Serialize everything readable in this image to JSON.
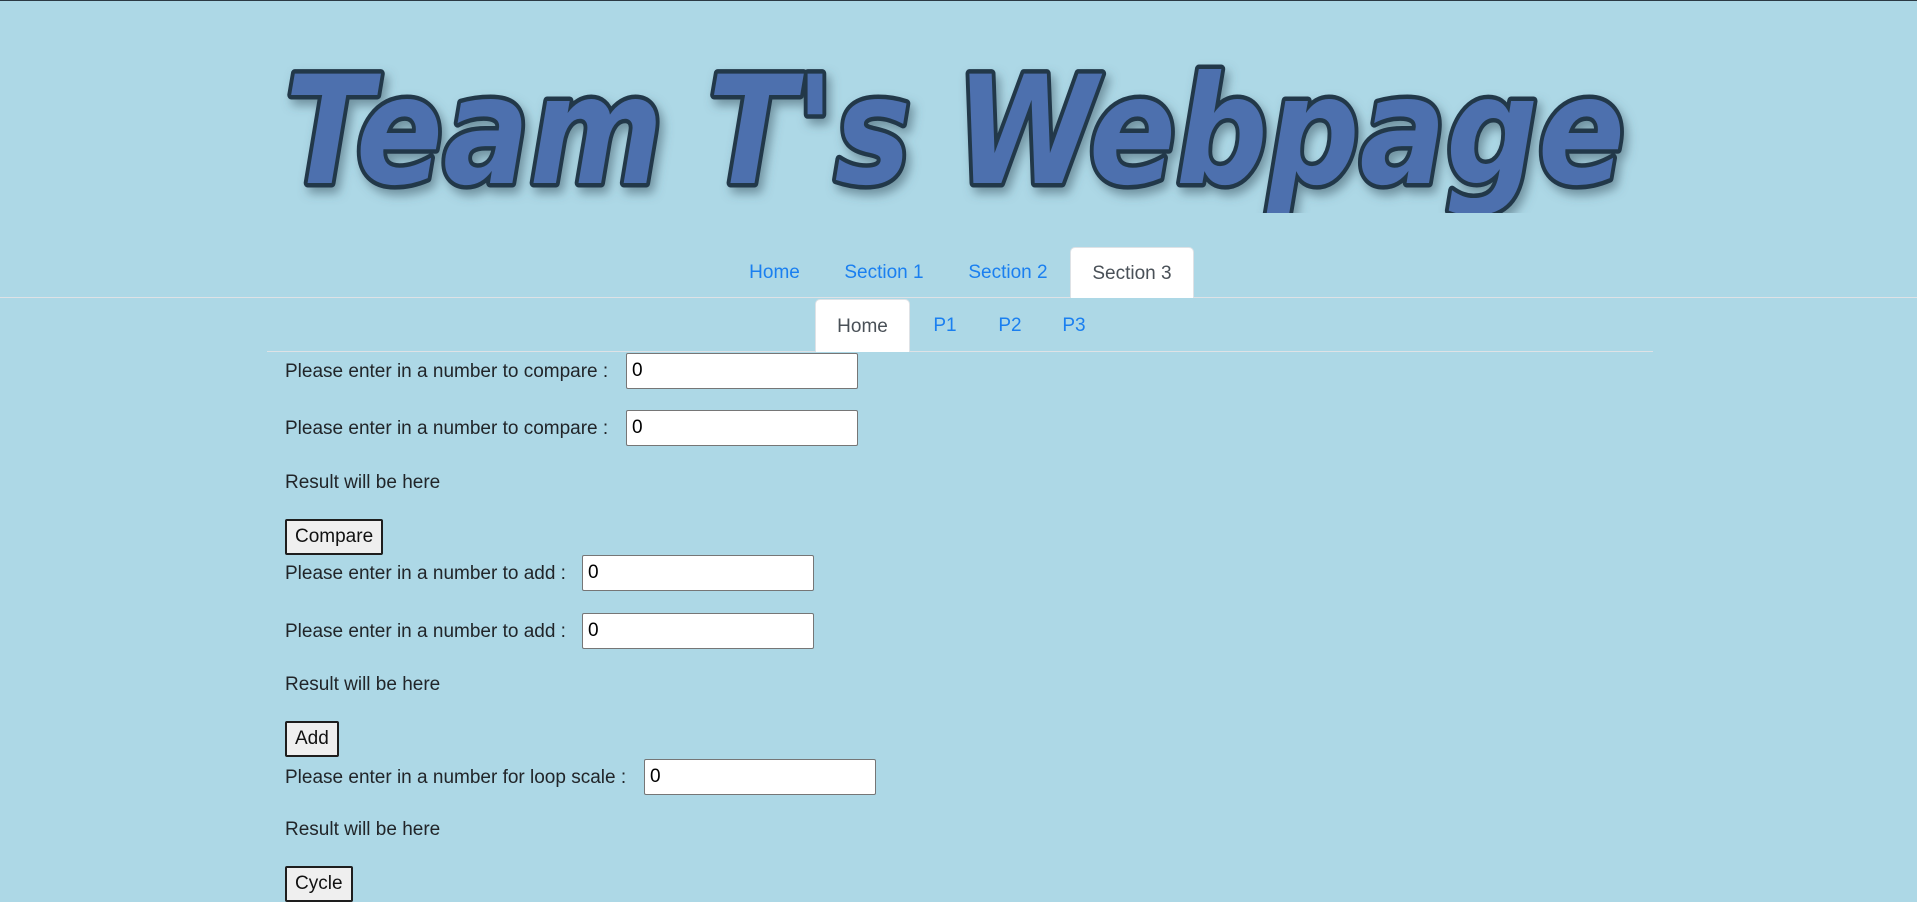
{
  "header": {
    "banner_text": "Team T's Webpage"
  },
  "nav": {
    "tabs": [
      {
        "label": "Home"
      },
      {
        "label": "Section 1"
      },
      {
        "label": "Section 2"
      },
      {
        "label": "Section 3",
        "active": true
      }
    ]
  },
  "subnav": {
    "tabs": [
      {
        "label": "Home",
        "active": true
      },
      {
        "label": "P1"
      },
      {
        "label": "P2"
      },
      {
        "label": "P3"
      }
    ]
  },
  "compare": {
    "prompt1": "Please enter in a number to compare :",
    "value1": "0",
    "prompt2": "Please enter in a number to compare :",
    "value2": "0",
    "result": "Result will be here",
    "button": "Compare"
  },
  "add": {
    "prompt1": "Please enter in a number to add :",
    "value1": "0",
    "prompt2": "Please enter in a number to add :",
    "value2": "0",
    "result": "Result will be here",
    "button": "Add"
  },
  "cycle": {
    "prompt": "Please enter in a number for loop scale :",
    "value": "0",
    "result": "Result will be here",
    "button": "Cycle"
  },
  "colors": {
    "background": "#add8e6",
    "link": "#1a7ff0",
    "banner_fill": "#4d6fae",
    "banner_outline": "#22394a"
  }
}
